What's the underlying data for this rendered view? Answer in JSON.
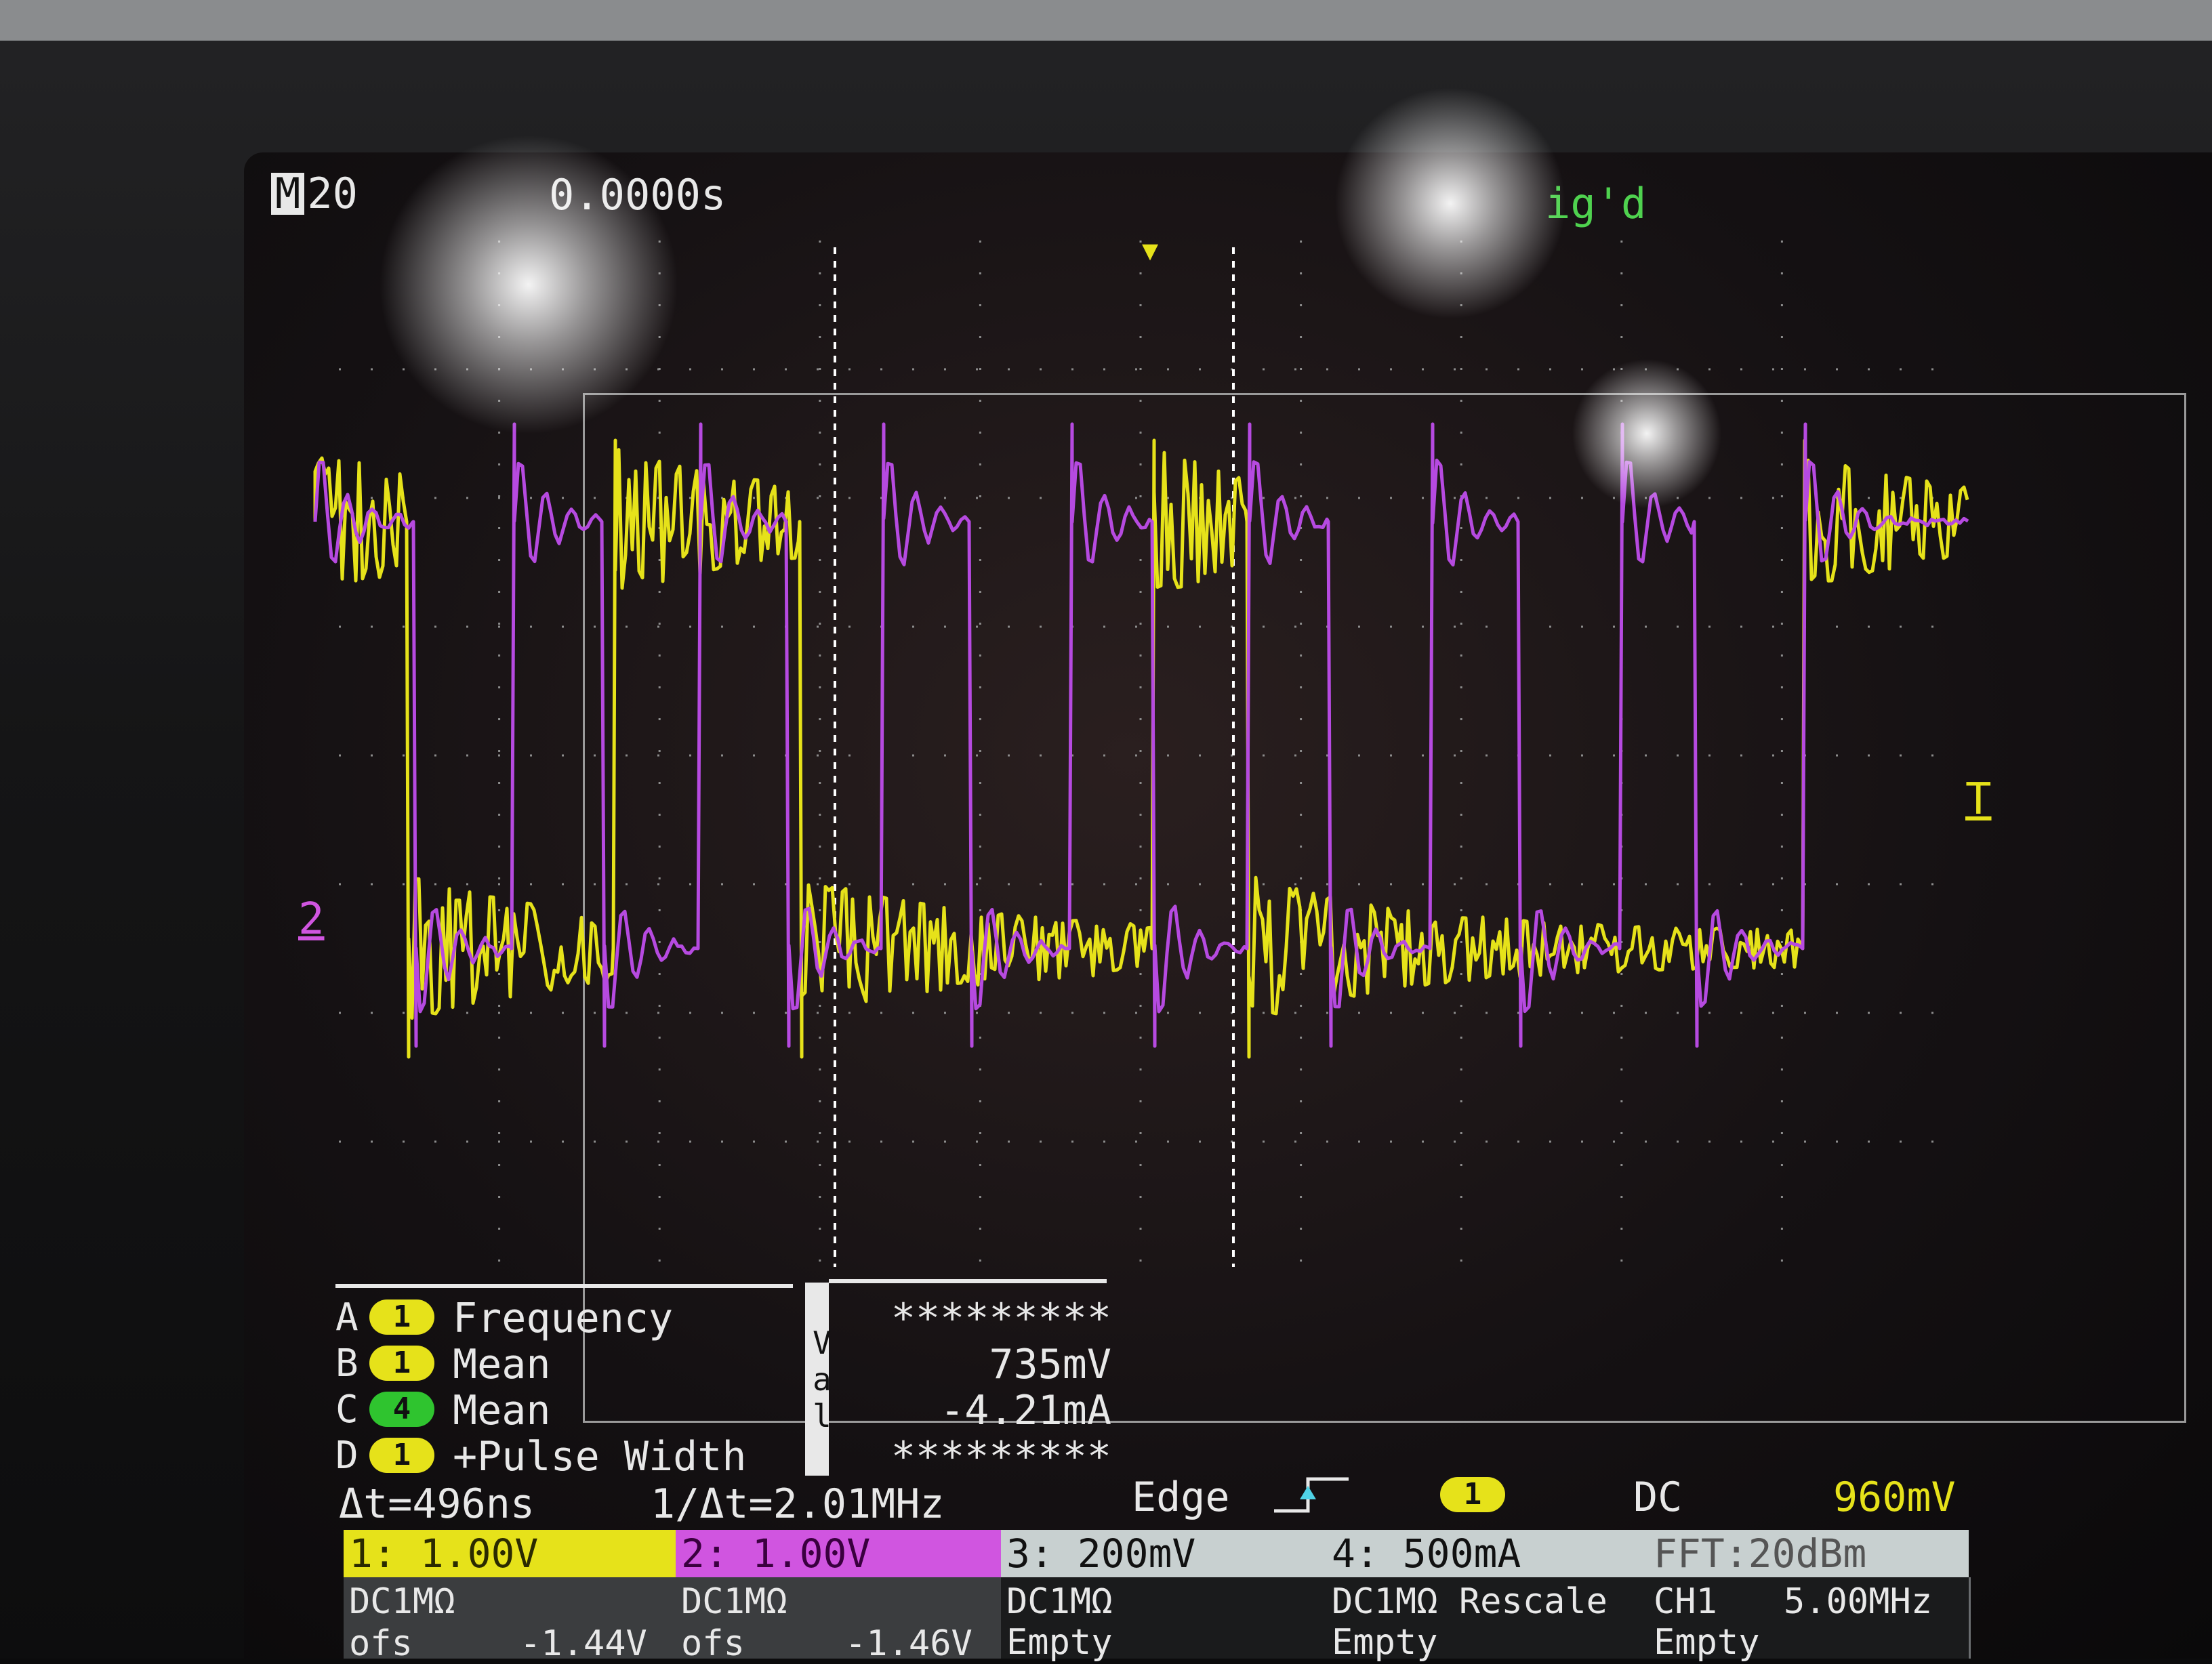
{
  "header": {
    "mode_badge": "M",
    "timebase": "20",
    "position": "0.0000s",
    "trigger_status": "ig'd"
  },
  "markers": {
    "trigger_pos": "▼",
    "ch2_ground": "2",
    "trigger_level": "T"
  },
  "measurements": [
    {
      "letter": "A",
      "channel": "1",
      "channel_color": "#e6e21a",
      "name": "Frequency",
      "value": "*********"
    },
    {
      "letter": "B",
      "channel": "1",
      "channel_color": "#e6e21a",
      "name": "Mean",
      "value": "735mV"
    },
    {
      "letter": "C",
      "channel": "4",
      "channel_color": "#2fc42f",
      "name": "Mean",
      "value": "-4.21mA"
    },
    {
      "letter": "D",
      "channel": "1",
      "channel_color": "#e6e21a",
      "name": "+Pulse Width",
      "value": "*********"
    }
  ],
  "val_label": "Val",
  "cursor": {
    "delta_t": "Δt=496ns",
    "inv_delta_t": "1/Δt=2.01MHz"
  },
  "trigger": {
    "type": "Edge",
    "slope_icon": "rising-edge-icon",
    "source": "1",
    "coupling": "DC",
    "level": "960mV"
  },
  "channels": [
    {
      "id": "ch1",
      "scale": "1: 1.00V",
      "coupling": "DC1MΩ",
      "offset_label": "ofs",
      "offset": "-1.44V",
      "bg": "#e6e21a",
      "fg": "#2a2a00"
    },
    {
      "id": "ch2",
      "scale": "2: 1.00V",
      "coupling": "DC1MΩ",
      "offset_label": "ofs",
      "offset": "-1.46V",
      "bg": "#d055e0",
      "fg": "#3a003f"
    },
    {
      "id": "ch3",
      "scale": "3: 200mV",
      "coupling": "DC1MΩ",
      "status": "Empty",
      "bg": "#c8d0d0",
      "fg": "#111111"
    },
    {
      "id": "ch4",
      "scale": "4: 500mA",
      "coupling": "DC1MΩ Rescale",
      "status": "Empty",
      "bg": "#c8d0d0",
      "fg": "#111111"
    },
    {
      "id": "fft",
      "scale": "FFT:20dBm",
      "coupling": "CH1",
      "freq": "5.00MHz",
      "status": "Empty",
      "bg": "#c8d0d0",
      "fg": "#555555"
    }
  ],
  "colors": {
    "ch1": "#e6e21a",
    "ch2": "#b64ae0",
    "ch4": "#2fc42f",
    "grid": "#8c8c8c"
  }
}
